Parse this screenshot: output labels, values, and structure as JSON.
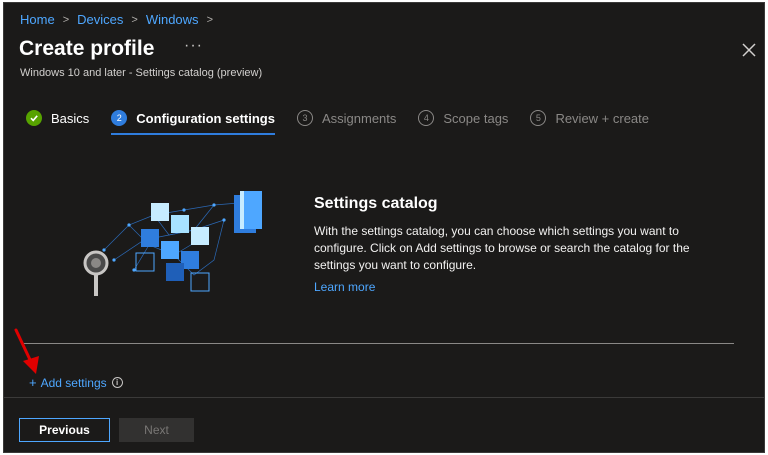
{
  "breadcrumb": {
    "items": [
      "Home",
      "Devices",
      "Windows"
    ],
    "separator": ">"
  },
  "header": {
    "title": "Create profile",
    "more": "···",
    "subtitle": "Windows 10 and later - Settings catalog (preview)"
  },
  "steps": [
    {
      "label": "Basics",
      "marker": "✓",
      "state": "done"
    },
    {
      "label": "Configuration settings",
      "marker": "2",
      "state": "active"
    },
    {
      "label": "Assignments",
      "marker": "3",
      "state": "pending"
    },
    {
      "label": "Scope tags",
      "marker": "4",
      "state": "pending"
    },
    {
      "label": "Review + create",
      "marker": "5",
      "state": "pending"
    }
  ],
  "catalog": {
    "title": "Settings catalog",
    "body": "With the settings catalog, you can choose which settings you want to configure. Click on Add settings to browse or search the catalog for the settings you want to configure.",
    "learn_more": "Learn more"
  },
  "add_settings": {
    "plus": "+",
    "label": "Add settings",
    "info": "i"
  },
  "footer": {
    "previous": "Previous",
    "next": "Next"
  },
  "icons": {
    "close": "close-icon",
    "check": "check-icon",
    "info": "info-icon",
    "arrow": "red-arrow-annotation"
  },
  "colors": {
    "background": "#1b1a19",
    "link": "#4ea7ff",
    "accent": "#2f7dde",
    "success": "#57a300",
    "muted": "#8a8886",
    "annotation": "#e00000"
  }
}
